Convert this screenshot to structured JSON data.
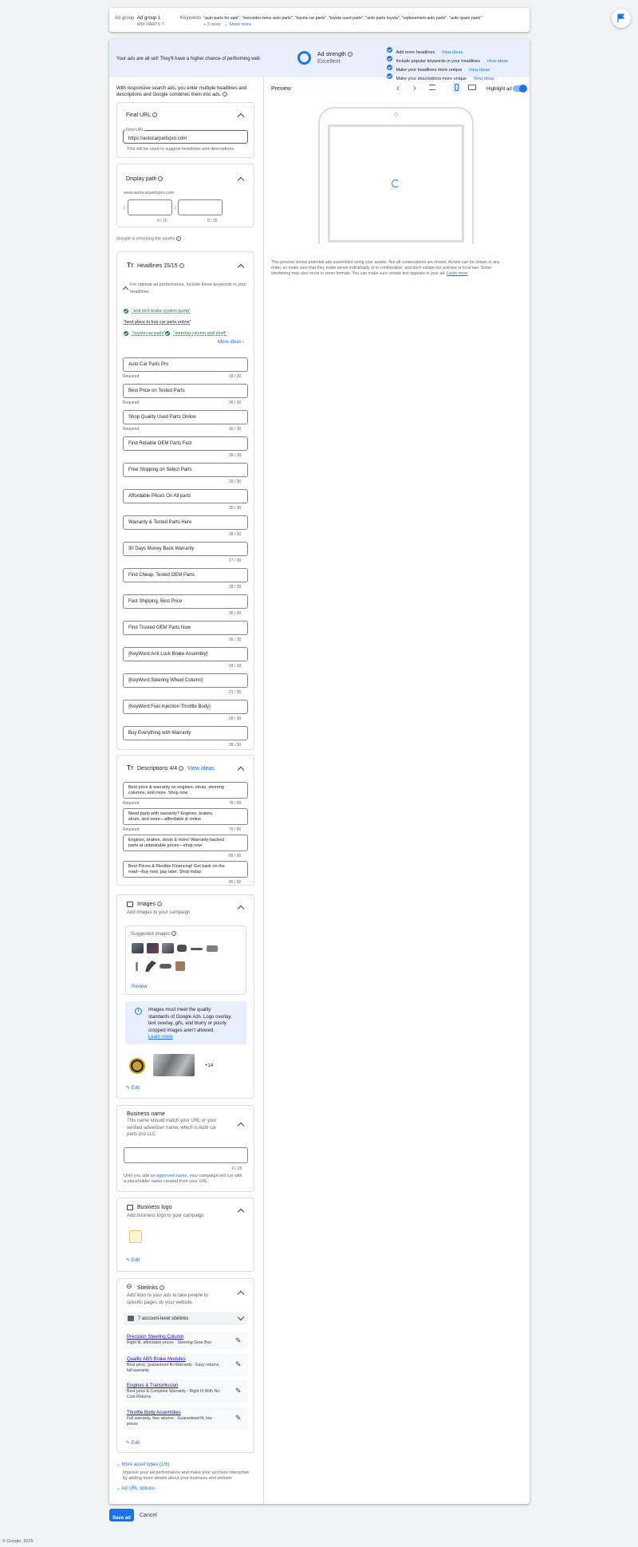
{
  "topbar": {
    "adgroup_label": "Ad group",
    "adgroup_name": "Ad group 1",
    "campaign_name": "MIX PARTS T",
    "keywords_label": "Keywords",
    "keywords_value": "\"auto parts for sale\", \"mercedes benz auto parts\", \"toyota car parts\", \"toyota used parts\", \"auto parts toyota\", \"replacement auto parts\", \"auto spare parts\"",
    "more_count": "+ 3 more",
    "show_more": "Show more"
  },
  "strength": {
    "message": "Your ads are all set! They'll have a higher chance of performing well.",
    "title": "Ad strength",
    "value": "Excellent",
    "tips": [
      {
        "text": "Add more headlines",
        "link": "View ideas"
      },
      {
        "text": "Include popular keywords in your headlines",
        "link": "View ideas"
      },
      {
        "text": "Make your headlines more unique",
        "link": "View ideas"
      },
      {
        "text": "Make your descriptions more unique",
        "link": "View ideas"
      }
    ]
  },
  "intro": "With responsive search ads, you enter multiple headlines and descriptions and Google combines them into ads.",
  "final_url": {
    "title": "Final URL",
    "field_label": "Final URL",
    "value": "https://autocarpartspro.com",
    "helper": "This will be used to suggest headlines and descriptions"
  },
  "display_path": {
    "title": "Display path",
    "domain": "www.autocarpartspro.com",
    "slash": "/",
    "sep": "/",
    "count1": "0 / 15",
    "count2": "0 / 15"
  },
  "choosing": "Google is choosing the assets",
  "headlines": {
    "title": "Headlines 15/15",
    "hint": "For optimal ad performance, include these keywords in your headlines",
    "keywords": [
      "\"anti lock brake system pump\"",
      "\"best place to buy car parts online\"",
      "\"toyota car parts\"",
      "\"steering column and shaft\""
    ],
    "more_ideas": "More ideas",
    "required": "Required",
    "items": [
      {
        "text": "Auto Car Parts Pro",
        "count": "18 / 30",
        "required": true
      },
      {
        "text": "Best Price on Tested Parts",
        "count": "26 / 30",
        "required": true
      },
      {
        "text": "Shop Quality Used Parts Online",
        "count": "30 / 30",
        "required": true
      },
      {
        "text": "Find Reliable OEM Parts Fast",
        "count": "28 / 30",
        "required": false
      },
      {
        "text": "Free Shipping on Select Parts",
        "count": "29 / 30",
        "required": false
      },
      {
        "text": "Affordable Prices On All parts",
        "count": "30 / 30",
        "required": false
      },
      {
        "text": "Warranty & Tested Parts Here",
        "count": "28 / 30",
        "required": false
      },
      {
        "text": "30 Days Money Back Warranty",
        "count": "27 / 30",
        "required": false
      },
      {
        "text": "Find Cheap, Tested OEM Parts",
        "count": "28 / 30",
        "required": false
      },
      {
        "text": "Fast Shipping, Best Price",
        "count": "25 / 30",
        "required": false
      },
      {
        "text": "Find Trusted OEM Parts Now",
        "count": "26 / 30",
        "required": false
      },
      {
        "text": "{KeyWord:Anti Lock Brake Assembly}",
        "count": "24 / 30",
        "required": false
      },
      {
        "text": "{KeyWord:Steering Wheel Column}",
        "count": "21 / 30",
        "required": false
      },
      {
        "text": "{KeyWord:Fuel Injection Throttle Body}",
        "count": "28 / 30",
        "required": false
      },
      {
        "text": "Buy Everything with Warranty",
        "count": "28 / 30",
        "required": false
      }
    ]
  },
  "descriptions": {
    "title": "Descriptions 4/4",
    "view_ideas": "View ideas",
    "items": [
      {
        "line1": "Best price & warranty on engines, struts, steering",
        "line2": "columns, and more. Shop now",
        "count": "78 / 90",
        "required": true
      },
      {
        "line1": "Need parts with warranty? Engines, brakes,",
        "line2": "struts, and more—affordable & online",
        "count": "79 / 90",
        "required": true
      },
      {
        "line1": "Engines, brakes, struts & more! Warranty-backed",
        "line2": "parts at unbeatable prices—shop now",
        "count": "85 / 90",
        "required": false
      },
      {
        "line1": "Best Prices & Flexible Financing! Get back on the",
        "line2": "road—buy now, pay later. Shop today",
        "count": "85 / 90",
        "required": false
      }
    ]
  },
  "images": {
    "title": "Images",
    "subtitle": "Add images to your campaign",
    "suggested": "Suggested images",
    "review": "Review",
    "notice": [
      "Images must meet the quality",
      "standards of Google Ads. Logo overlay,",
      "text overlay, gifs, and blurry or poorly",
      "cropped images aren't allowed."
    ],
    "learn_more": "Learn more",
    "plus": "+14",
    "edit": "Edit"
  },
  "business_name": {
    "title": "Business name",
    "desc": [
      "This name should match your URL or your",
      "verified advertiser name, which is Auto car",
      "parts pro LLC"
    ],
    "count": "0 / 25",
    "note_pre": "Until you add an ",
    "note_link": "approved name",
    "note_post": ", your campaign will run with",
    "note_line2": "a placeholder name created from your URL."
  },
  "business_logo": {
    "title": "Business logo",
    "subtitle": "Add business logo to your campaign",
    "edit": "Edit"
  },
  "sitelinks": {
    "title": "Sitelinks",
    "desc": [
      "Add links to your ads to take people to",
      "specific pages on your website."
    ],
    "account_level": "7 account-level sitelinks",
    "items": [
      {
        "title": "Precision Steering Column",
        "line1": "Right fit, affordable prices · Steering Gear Box",
        "line2": ""
      },
      {
        "title": "Quality ABS Brake Modules",
        "line1": "Best price, guaranteed fit+Warranty · Easy returns,",
        "line2": "full warranty"
      },
      {
        "title": "Engines & Transmission",
        "line1": "Best price & Complete Warranty · Right fit With No-",
        "line2": "Cost Returns"
      },
      {
        "title": "Throttle Body Assemblies",
        "line1": "Full warranty, free returns · Guaranteed fit, low",
        "line2": "prices"
      }
    ],
    "edit": "Edit"
  },
  "more_assets": {
    "title": "More asset types (1/6)",
    "desc": [
      "Improve your ad performance and make your ad more interactive",
      "by adding more details about your business and website"
    ],
    "url_options": "Ad URL options"
  },
  "preview": {
    "title": "Preview",
    "highlight": "Highlight ad",
    "note": [
      "This preview shows potential ads assembled using your assets. Not all combinations are shown. Assets can be shown in any",
      "order, so make sure that they make sense individually or in combination, and don't violate our policies or local law. Some",
      "shortening may also occur in some formats. You can make sure certain text appears in your ad. "
    ],
    "learn_more": "Learn more"
  },
  "actions": {
    "save": "Save ad",
    "cancel": "Cancel"
  },
  "footer": "© Google, 2025"
}
